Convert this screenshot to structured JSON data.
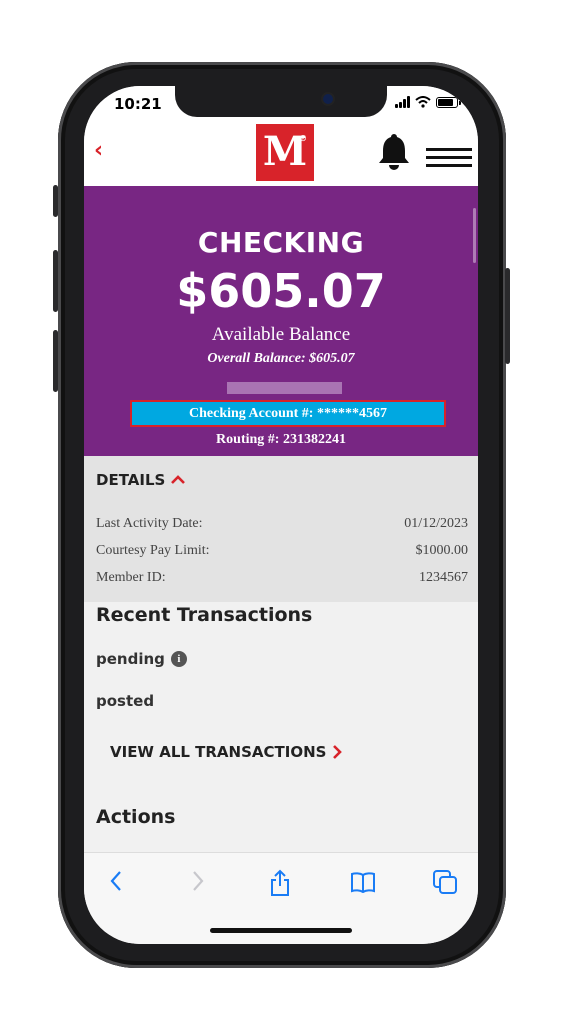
{
  "status_bar": {
    "time": "10:21"
  },
  "header": {
    "logo_text": "M",
    "logo_mark": "®"
  },
  "account": {
    "title": "CHECKING",
    "balance": "$605.07",
    "available_label": "Available Balance",
    "overall_balance": "Overall Balance: $605.07",
    "account_number": "Checking Account #: ******4567",
    "routing_number": "Routing #: 231382241"
  },
  "details": {
    "heading": "DETAILS",
    "rows": [
      {
        "label": "Last Activity Date:",
        "value": "01/12/2023"
      },
      {
        "label": "Courtesy Pay Limit:",
        "value": "$1000.00"
      },
      {
        "label": "Member ID:",
        "value": "1234567"
      }
    ]
  },
  "transactions": {
    "heading": "Recent Transactions",
    "pending_label": "pending",
    "posted_label": "posted",
    "view_all_label": "VIEW ALL TRANSACTIONS"
  },
  "actions": {
    "heading": "Actions"
  },
  "colors": {
    "brand_red": "#d8232a",
    "panel_purple": "#782683",
    "account_highlight": "#00a8e1",
    "ios_blue": "#1a7cf5"
  },
  "icons": [
    "back-chevron-icon",
    "bell-icon",
    "hamburger-menu-icon",
    "info-icon",
    "chevron-right-icon",
    "safari-back-icon",
    "safari-forward-icon",
    "share-icon",
    "bookmarks-icon",
    "tabs-icon"
  ]
}
